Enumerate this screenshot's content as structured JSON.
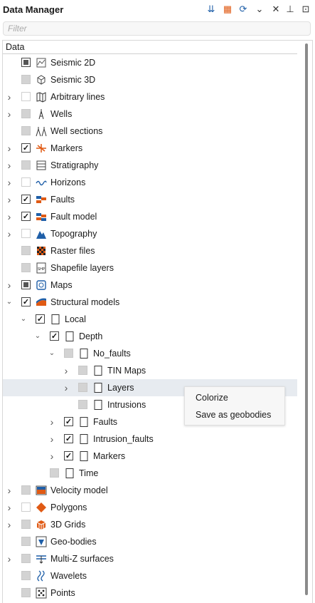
{
  "title": "Data Manager",
  "toolbar": [
    {
      "name": "import-icon",
      "glyph": "⇊"
    },
    {
      "name": "data-settings-icon",
      "glyph": "▦"
    },
    {
      "name": "refresh-icon",
      "glyph": "⟳"
    },
    {
      "name": "dropdown-chevron-icon",
      "glyph": "⌄"
    },
    {
      "name": "close-icon",
      "glyph": "✕"
    },
    {
      "name": "pin-icon",
      "glyph": "⊥"
    },
    {
      "name": "panel-menu-icon",
      "glyph": "⊡"
    }
  ],
  "filter": {
    "placeholder": "Filter",
    "value": ""
  },
  "column_header": "Data",
  "tree": [
    {
      "label": "Seismic 2D",
      "level": 0,
      "arrow": "",
      "check": "filled",
      "icon": "seismic-2d-icon"
    },
    {
      "label": "Seismic 3D",
      "level": 0,
      "arrow": "",
      "check": "partial",
      "icon": "seismic-3d-icon"
    },
    {
      "label": "Arbitrary lines",
      "level": 0,
      "arrow": "collapsed",
      "check": "unchecked",
      "icon": "arbitrary-lines-icon"
    },
    {
      "label": "Wells",
      "level": 0,
      "arrow": "collapsed",
      "check": "partial",
      "icon": "wells-icon"
    },
    {
      "label": "Well sections",
      "level": 0,
      "arrow": "",
      "check": "partial",
      "icon": "well-sections-icon"
    },
    {
      "label": "Markers",
      "level": 0,
      "arrow": "collapsed",
      "check": "checked",
      "icon": "markers-icon"
    },
    {
      "label": "Stratigraphy",
      "level": 0,
      "arrow": "collapsed",
      "check": "partial",
      "icon": "stratigraphy-icon"
    },
    {
      "label": "Horizons",
      "level": 0,
      "arrow": "collapsed",
      "check": "unchecked",
      "icon": "horizons-icon"
    },
    {
      "label": "Faults",
      "level": 0,
      "arrow": "collapsed",
      "check": "checked",
      "icon": "faults-icon"
    },
    {
      "label": "Fault model",
      "level": 0,
      "arrow": "collapsed",
      "check": "checked",
      "icon": "fault-model-icon"
    },
    {
      "label": "Topography",
      "level": 0,
      "arrow": "collapsed",
      "check": "unchecked",
      "icon": "topography-icon"
    },
    {
      "label": "Raster files",
      "level": 0,
      "arrow": "",
      "check": "partial",
      "icon": "raster-files-icon"
    },
    {
      "label": "Shapefile layers",
      "level": 0,
      "arrow": "",
      "check": "partial",
      "icon": "shapefile-icon"
    },
    {
      "label": "Maps",
      "level": 0,
      "arrow": "collapsed",
      "check": "filled",
      "icon": "maps-icon"
    },
    {
      "label": "Structural models",
      "level": 0,
      "arrow": "expanded",
      "check": "checked",
      "icon": "structural-models-icon"
    },
    {
      "label": "Local",
      "level": 1,
      "arrow": "expanded",
      "check": "checked",
      "icon": "folder-icon"
    },
    {
      "label": "Depth",
      "level": 2,
      "arrow": "expanded",
      "check": "checked",
      "icon": "folder-icon"
    },
    {
      "label": "No_faults",
      "level": 3,
      "arrow": "expanded",
      "check": "partial",
      "icon": "folder-icon"
    },
    {
      "label": "TIN Maps",
      "level": 4,
      "arrow": "collapsed",
      "check": "partial",
      "icon": "folder-icon"
    },
    {
      "label": "Layers",
      "level": 4,
      "arrow": "collapsed",
      "check": "partial",
      "icon": "folder-icon",
      "selected": true
    },
    {
      "label": "Intrusions",
      "level": 4,
      "arrow": "",
      "check": "partial",
      "icon": "folder-icon"
    },
    {
      "label": "Faults",
      "level": 3,
      "arrow": "collapsed",
      "check": "checked",
      "icon": "folder-icon"
    },
    {
      "label": "Intrusion_faults",
      "level": 3,
      "arrow": "collapsed",
      "check": "checked",
      "icon": "folder-icon"
    },
    {
      "label": "Markers",
      "level": 3,
      "arrow": "collapsed",
      "check": "checked",
      "icon": "folder-icon"
    },
    {
      "label": "Time",
      "level": 2,
      "arrow": "",
      "check": "partial",
      "icon": "folder-icon"
    },
    {
      "label": "Velocity model",
      "level": 0,
      "arrow": "collapsed",
      "check": "partial",
      "icon": "velocity-model-icon"
    },
    {
      "label": "Polygons",
      "level": 0,
      "arrow": "collapsed",
      "check": "unchecked",
      "icon": "polygons-icon"
    },
    {
      "label": "3D Grids",
      "level": 0,
      "arrow": "collapsed",
      "check": "partial",
      "icon": "3d-grids-icon"
    },
    {
      "label": "Geo-bodies",
      "level": 0,
      "arrow": "",
      "check": "partial",
      "icon": "geo-bodies-icon"
    },
    {
      "label": "Multi-Z surfaces",
      "level": 0,
      "arrow": "collapsed",
      "check": "partial",
      "icon": "multi-z-surfaces-icon"
    },
    {
      "label": "Wavelets",
      "level": 0,
      "arrow": "",
      "check": "partial",
      "icon": "wavelets-icon"
    },
    {
      "label": "Points",
      "level": 0,
      "arrow": "",
      "check": "partial",
      "icon": "points-icon"
    }
  ],
  "context_menu": {
    "items": [
      "Colorize",
      "Save as geobodies"
    ]
  },
  "colors": {
    "accent_blue": "#1f5fa8",
    "orange": "#e05a14",
    "selection": "#e7ebf0"
  }
}
